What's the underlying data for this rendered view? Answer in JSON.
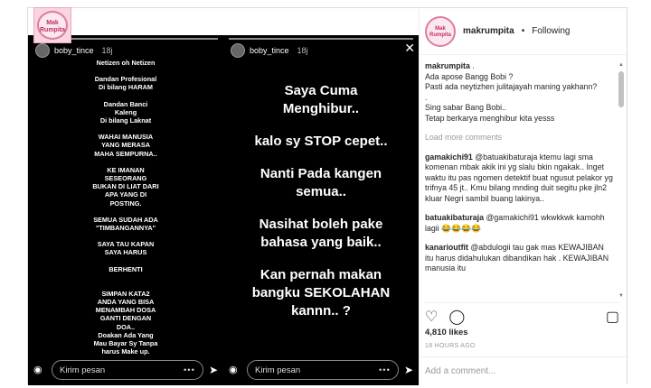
{
  "brand_logo_text": "Mak Rumpita",
  "stories": [
    {
      "username": "boby_tince",
      "time": "18j",
      "lines": [
        "Netizen oh Netizen",
        "",
        "Dandan Profesional",
        "Di bilang HARAM",
        "",
        "Dandan Banci",
        "Kaleng",
        "Di bilang Laknat",
        "",
        "WAHAI MANUSIA",
        "YANG MERASA",
        "MAHA SEMPURNA..",
        "",
        "KE IMANAN",
        "SESEORANG",
        "BUKAN DI LIAT DARI",
        "APA YANG DI",
        "POSTING.",
        "",
        "SEMUA SUDAH ADA",
        "\"TIMBANGANNYA\"",
        "",
        "SAYA TAU KAPAN",
        "SAYA HARUS",
        "",
        "BERHENTI",
        "",
        "",
        "SIMPAN KATA2",
        "ANDA YANG BISA",
        "MENAMBAH DOSA",
        "GANTI DENGAN",
        "DOA..",
        "Doakan Ada Yang",
        "Mau Bayar Sy Tanpa",
        "harus Make up."
      ],
      "reply_placeholder": "Kirim pesan"
    },
    {
      "username": "boby_tince",
      "time": "18j",
      "lines": [
        "Saya Cuma",
        "Menghibur..",
        "",
        "kalo sy STOP cepet..",
        "",
        "Nanti Pada kangen",
        "semua..",
        "",
        "Nasihat boleh pake",
        "bahasa yang baik..",
        "",
        "Kan pernah makan",
        "bangku SEKOLAHAN",
        "kannn.. ?"
      ],
      "reply_placeholder": "Kirim pesan"
    }
  ],
  "post": {
    "account": "makrumpita",
    "follow_status": "Following",
    "caption": {
      "user": "makrumpita",
      "lines": [
        ".",
        "Ada apose Bangg Bobi ?",
        "Pasti ada neytizhen julitajayah maning yakhann?",
        ".",
        "Sing sabar Bang Bobi..",
        "Tetap berkarya menghibur kita yesss"
      ]
    },
    "load_more": "Load more comments",
    "comments": [
      {
        "user": "gamakichi91",
        "text": "@batuakibaturaja ktemu lagi sma komenan mbak akik ini yg slalu bkin ngakak.. Inget waktu itu pas ngomen detektif buat ngusut pelakor yg trifnya 45 jt.. Kmu bilang mnding duit segitu pke jln2 kluar Negri sambil buang lakinya.."
      },
      {
        "user": "batuakibaturaja",
        "text": "@gamakichi91 wkwkkwk kamohh lagii 😂😂😂😂"
      },
      {
        "user": "kanarioutfit",
        "text": "@abdulogii tau gak mas KEWAJIBAN itu harus didahulukan dibandikan hak . KEWAJIBAN manusia itu"
      }
    ],
    "likes": "4,810 likes",
    "time_ago": "18 HOURS AGO",
    "add_comment_placeholder": "Add a comment..."
  }
}
